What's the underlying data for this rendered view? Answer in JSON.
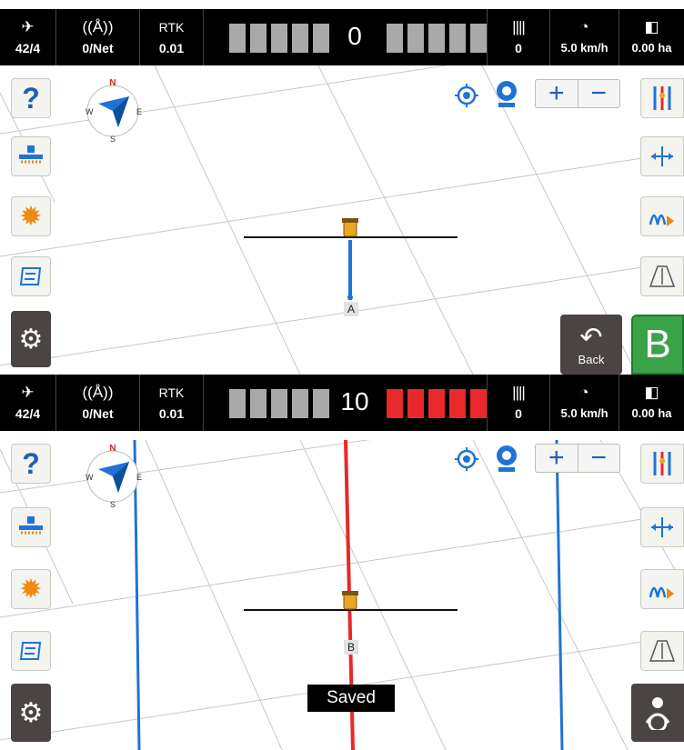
{
  "screen1": {
    "status": {
      "satellites": "42/4",
      "network_status": "0/Net",
      "rtk_label": "RTK",
      "rtk_value": "0.01",
      "offset": "0",
      "grid_value": "0",
      "speed": "5.0 km/h",
      "area": "0.00 ha"
    },
    "point_label": "A",
    "back_label": "Back",
    "b_button_label": "B"
  },
  "screen2": {
    "status": {
      "satellites": "42/4",
      "network_status": "0/Net",
      "rtk_label": "RTK",
      "rtk_value": "0.01",
      "offset": "10",
      "grid_value": "0",
      "speed": "5.0 km/h",
      "area": "0.00 ha"
    },
    "point_label": "B",
    "toast": "Saved"
  },
  "icons": {
    "compass_n": "N",
    "compass_s": "S",
    "compass_w": "W",
    "compass_e": "E",
    "help": "?",
    "zoom_in": "+",
    "zoom_out": "−"
  },
  "colors": {
    "guidance_red": "#e8282b",
    "guidance_blue": "#1f73d6",
    "b_button": "#3aa347",
    "dark_button": "#4a4542"
  }
}
